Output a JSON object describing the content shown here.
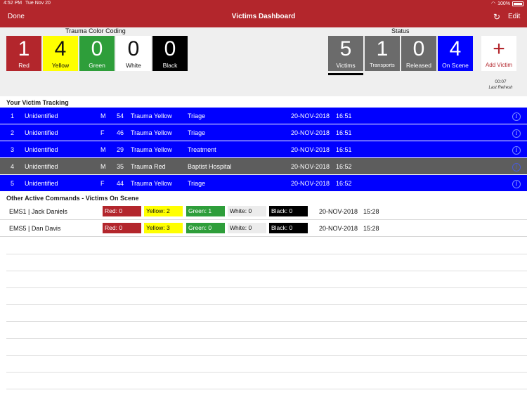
{
  "status_bar": {
    "time": "4:52 PM",
    "date": "Tue Nov 20",
    "battery": "100%"
  },
  "nav": {
    "done_label": "Done",
    "title": "Victims Dashboard",
    "edit_label": "Edit",
    "refresh_icon": "refresh-icon"
  },
  "trauma_coding": {
    "title": "Trauma Color Coding",
    "tiles": [
      {
        "value": "1",
        "label": "Red",
        "color": "#b3262c"
      },
      {
        "value": "4",
        "label": "Yellow",
        "color": "#ffff00"
      },
      {
        "value": "0",
        "label": "Green",
        "color": "#2e9e3a"
      },
      {
        "value": "0",
        "label": "White",
        "color": "#ffffff"
      },
      {
        "value": "0",
        "label": "Black",
        "color": "#000000"
      }
    ]
  },
  "status": {
    "title": "Status",
    "tiles": [
      {
        "value": "5",
        "label": "Victims",
        "color": "#6b6b6b"
      },
      {
        "value": "1",
        "label": "Transports",
        "color": "#6b6b6b"
      },
      {
        "value": "0",
        "label": "Released",
        "color": "#6b6b6b"
      },
      {
        "value": "4",
        "label": "On Scene",
        "color": "#0000ff"
      }
    ],
    "add_victim": {
      "symbol": "+",
      "label": "Add Victim"
    },
    "refresh_time": "00:07",
    "refresh_label": "Last Refresh"
  },
  "victim_tracking": {
    "title": "Your Victim Tracking",
    "rows": [
      {
        "num": "1",
        "name": "Unidentified",
        "sex": "M",
        "age": "54",
        "trauma": "Trauma Yellow",
        "location": "Triage",
        "date": "20-NOV-2018",
        "time": "16:51",
        "info": "i"
      },
      {
        "num": "2",
        "name": "Unidentified",
        "sex": "F",
        "age": "46",
        "trauma": "Trauma Yellow",
        "location": "Triage",
        "date": "20-NOV-2018",
        "time": "16:51",
        "info": "i"
      },
      {
        "num": "3",
        "name": "Unidentified",
        "sex": "M",
        "age": "29",
        "trauma": "Trauma Yellow",
        "location": "Treatment",
        "date": "20-NOV-2018",
        "time": "16:51",
        "info": "i"
      },
      {
        "num": "4",
        "name": "Unidentified",
        "sex": "M",
        "age": "35",
        "trauma": "Trauma Red",
        "location": "Baptist Hospital",
        "date": "20-NOV-2018",
        "time": "16:52",
        "info": "i"
      },
      {
        "num": "5",
        "name": "Unidentified",
        "sex": "F",
        "age": "44",
        "trauma": "Trauma Yellow",
        "location": "Triage",
        "date": "20-NOV-2018",
        "time": "16:52",
        "info": "i"
      }
    ]
  },
  "other_commands": {
    "title": "Other Active Commands - Victims On Scene",
    "rows": [
      {
        "name": "EMS1 | Jack Daniels",
        "red": "Red: 0",
        "yellow": "Yellow: 2",
        "green": "Green: 1",
        "white": "White: 0",
        "black": "Black: 0",
        "date": "20-NOV-2018",
        "time": "15:28"
      },
      {
        "name": "EMS5 | Dan Davis",
        "red": "Red: 0",
        "yellow": "Yellow: 3",
        "green": "Green: 0",
        "white": "White: 0",
        "black": "Black: 0",
        "date": "20-NOV-2018",
        "time": "15:28"
      }
    ]
  }
}
